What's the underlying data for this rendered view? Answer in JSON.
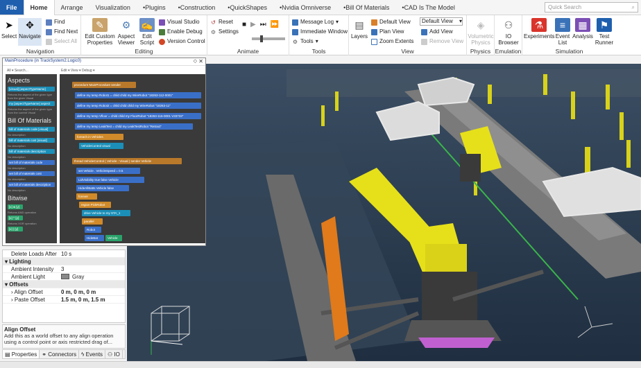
{
  "tabs": [
    "File",
    "Home",
    "Arrange",
    "Visualization",
    "•Plugins",
    "•Construction",
    "•QuickShapes",
    "•Nvidia Omniverse",
    "•Bill Of Materials",
    "•CAD Is The Model"
  ],
  "search": {
    "placeholder": "Quick Search"
  },
  "ribbon": {
    "navigation": {
      "label": "Navigation",
      "select": "Select",
      "navigate": "Navigate",
      "find": "Find",
      "find_next": "Find Next",
      "select_all": "Select All"
    },
    "editing": {
      "label": "Editing",
      "edit_custom_properties": "Edit Custom Properties",
      "aspect_viewer": "Aspect Viewer",
      "edit_script": "Edit Script",
      "visual_studio": "Visual Studio",
      "enable_debug": "Enable Debug",
      "version_control": "Version Control"
    },
    "animate": {
      "label": "Animate",
      "reset": "Reset",
      "settings": "Settings"
    },
    "tools": {
      "label": "Tools",
      "message_log": "Message Log",
      "immediate_window": "Immediate Window",
      "tools": "Tools"
    },
    "view": {
      "label": "View",
      "layers": "Layers",
      "default_view": "Default View",
      "plan_view": "Plan View",
      "zoom_extents": "Zoom Extents",
      "default_view_select": "Default View",
      "add_view": "Add View",
      "remove_view": "Remove View"
    },
    "physics": {
      "label": "Physics",
      "volumetric_physics": "Volumetric Physics"
    },
    "emulation": {
      "label": "Emulation",
      "io_browser": "IO Browser"
    },
    "simulation": {
      "label": "Simulation",
      "experiments": "Experiments",
      "event_list": "Event List",
      "analysis": "Analysis",
      "test_runner": "Test Runner"
    }
  },
  "logic_editor": {
    "title": "MainProcedure (in TrackSystem2.Logic0)",
    "palette_toolbar": "All ▾  Search...",
    "canvas_toolbar": "Edit ▾  View ▾  Debug ▾",
    "categories": [
      {
        "name": "Aspects",
        "blocks": [
          {
            "label": "[visual] [aspectTypeName]",
            "desc": "Returns the aspect of the given type from the given Visual"
          },
          {
            "label": "my [aspectTypeName] aspect",
            "desc": "Returns the aspect of the given type from the current Visual"
          }
        ]
      },
      {
        "name": "Bill Of Materials",
        "blocks": [
          {
            "label": "bill of materials code  [visual]",
            "desc": "No description"
          },
          {
            "label": "bill of materials cost  [visual]",
            "desc": "No description"
          },
          {
            "label": "bill of materials description",
            "desc": "No description"
          },
          {
            "label": "set bill of materials code",
            "desc": "No description"
          },
          {
            "label": "set bill of materials cost",
            "desc": "No description"
          },
          {
            "label": "set bill of materials description",
            "desc": "No description"
          }
        ]
      },
      {
        "name": "Bitwise",
        "blocks": [
          {
            "label": "[x] & [y]",
            "desc": "Returns AND operation"
          },
          {
            "label": "[x] ^ [y]",
            "desc": "Returns XOR operation"
          },
          {
            "label": "[x] | [y]",
            "desc": ""
          }
        ]
      }
    ],
    "code": {
      "procedure": "procedure  MainProcedure  sender",
      "defines": [
        "define my temp  Robot1  =  child  child  my WireRobot  \"18263-112-0001\"",
        "define my temp  Robot2  =  child  child  child  my WireRobot  \"18263-11\"",
        "define my temp  Vfloor  =  child  child  my FloorRobot  \"18263-116-0001 V33733\"",
        "define my temp  LeakTest  =  child  my LeakTestRobot  \"Retract\""
      ],
      "foreach": "foreach  in  Vehicles",
      "vehiclecontrol": "VehicleControl  visual",
      "thread": "thread  VehicleControl ( Vehicle : Visual )  sender  Vehicle",
      "set": "set  Vehicle  .  VehicleSpeed  =  0.5",
      "lidvis": "LidVisibility  true  false  Vehicle",
      "hidekit": "HideAllBatts  Vehicle  false",
      "forever": "forever",
      "region": "region  PickRobot",
      "drive": "drive  Vehicle  to  my STA_1",
      "parallel": "parallel",
      "robot": "Robot",
      "hidebat": "HideBat",
      "hb_target": "Vehicle"
    }
  },
  "properties": {
    "rows": [
      {
        "type": "row",
        "key": "Delete Loads After",
        "value": "10 s"
      },
      {
        "type": "section",
        "key": "Lighting"
      },
      {
        "type": "row",
        "key": "Ambient Intensity",
        "value": "3"
      },
      {
        "type": "color",
        "key": "Ambient Light",
        "value": "Gray"
      },
      {
        "type": "section",
        "key": "Offsets"
      },
      {
        "type": "row",
        "key": "Align Offset",
        "value": "0 m, 0 m, 0 m"
      },
      {
        "type": "row",
        "key": "Paste Offset",
        "value": "1.5 m, 0 m, 1.5 m"
      }
    ],
    "help_title": "Align Offset",
    "help_desc": "Add this as a world offset to any align operation using a control point or axis restricted drag of...",
    "tabs": [
      "Properties",
      "Connectors",
      "Events",
      "IO"
    ]
  },
  "colors": {
    "accent": "#1f5fae",
    "robot_yellow": "#e6e01a",
    "conveyor": "#6b6b6b",
    "floor": "#2d3f54"
  }
}
